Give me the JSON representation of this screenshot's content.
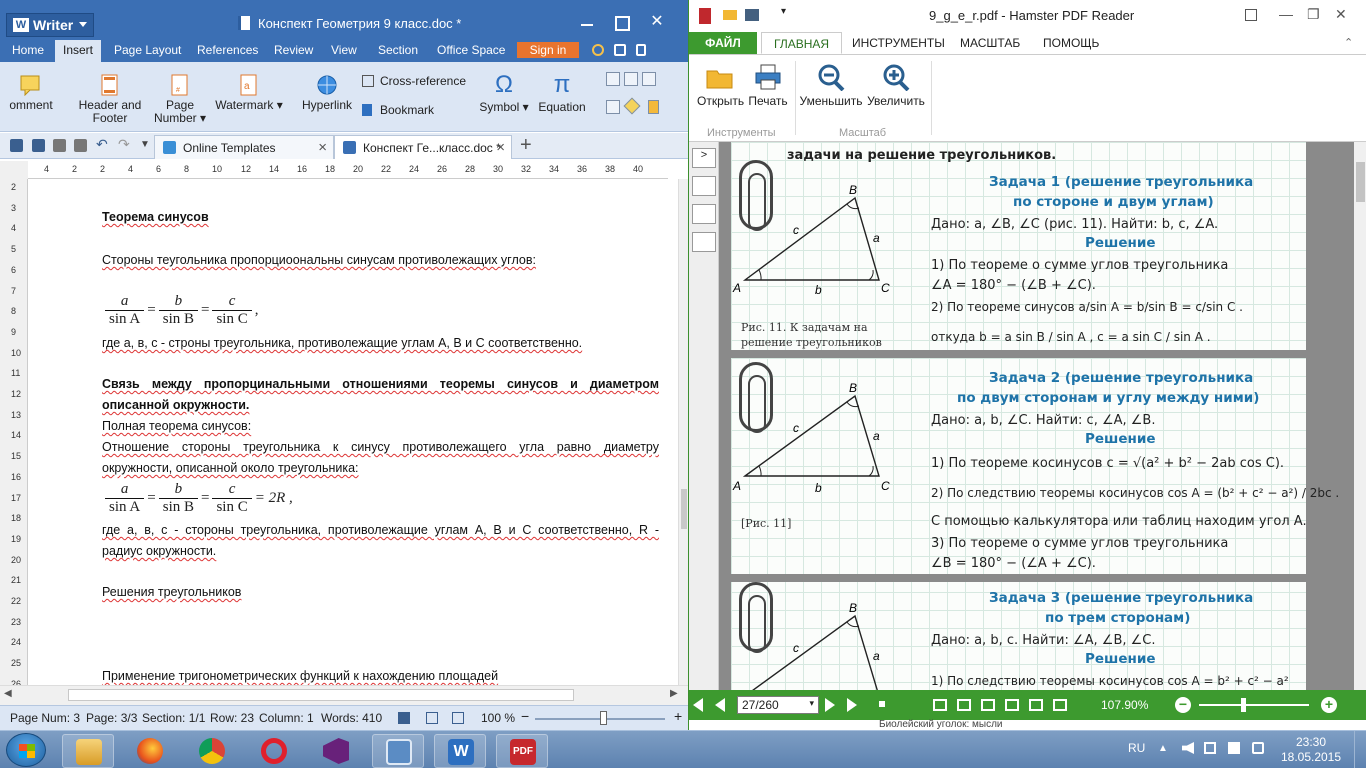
{
  "writer": {
    "app_name": "Writer",
    "doc_title": "Конспект Геометрия 9 класс.doc *",
    "menu_tabs": [
      "Home",
      "Insert",
      "Page Layout",
      "References",
      "Review",
      "View",
      "Section",
      "Office Space"
    ],
    "active_tab": "Insert",
    "signin": "Sign in",
    "ribbon": {
      "comment": "omment",
      "header_footer": [
        "Header and",
        "Footer"
      ],
      "page_number": [
        "Page",
        "Number"
      ],
      "watermark": "Watermark",
      "hyperlink": "Hyperlink",
      "cross_reference": "Cross-reference",
      "bookmark": "Bookmark",
      "symbol": "Symbol",
      "equation": "Equation"
    },
    "tabs": [
      {
        "label": "Online Templates"
      },
      {
        "label": "Конспект Ге...класс.doc *"
      }
    ],
    "ruler_h": [
      "4",
      "2",
      "2",
      "4",
      "6",
      "8",
      "10",
      "12",
      "14",
      "16",
      "18",
      "20",
      "22",
      "24",
      "26",
      "28",
      "30",
      "32",
      "34",
      "36",
      "38",
      "40"
    ],
    "ruler_v": [
      "2",
      "3",
      "4",
      "5",
      "6",
      "7",
      "8",
      "9",
      "10",
      "11",
      "12",
      "13",
      "14",
      "15",
      "16",
      "17",
      "18",
      "19",
      "20",
      "21",
      "22",
      "23",
      "24",
      "25",
      "26"
    ],
    "content": {
      "sine_theorem_title": "Теорема синусов",
      "sides_text": "Стороны теугольника пропорциоональны синусам противолежащих углов:",
      "where1": "где    a, в, с - строны треугольника, противолежащие углам А, В и С соответственно.",
      "relation_title_1": "Связь между пропорцинальными отношениями теоремы синусов и диаметром",
      "relation_title_2": "описанной окружности.",
      "full_theorem": "Полная теорема синусов:",
      "ratio_line1": "Отношение стороны треугольника к синусу противолежащего угла равно диаметру",
      "ratio_line2": "окружности, описанной около треугольника:",
      "where2_line1": "где а, в, с - стороны треугольника, противолежащие углам А, В и С соответственно, R -",
      "where2_line2": "радиус    окружности.",
      "solutions": "Решения треугольников",
      "application": "Применение тригонометрических функций к нахождению площадей",
      "formula1": {
        "nums": [
          "a",
          "b",
          "c"
        ],
        "dens": [
          "sin A",
          "sin B",
          "sin C"
        ],
        "tail": ","
      },
      "formula2": {
        "nums": [
          "a",
          "b",
          "c"
        ],
        "dens": [
          "sin A",
          "sin B",
          "sin C"
        ],
        "tail": "= 2R ,"
      }
    },
    "status": {
      "page_num": "Page Num: 3",
      "page": "Page: 3/3",
      "section": "Section: 1/1",
      "row": "Row: 23",
      "column": "Column: 1",
      "words": "Words: 410",
      "zoom": "100 %"
    }
  },
  "pdf": {
    "title": "9_g_e_r.pdf - Hamster PDF Reader",
    "menus": [
      "ФАЙЛ",
      "ГЛАВНАЯ",
      "ИНСТРУМЕНТЫ",
      "МАСШТАБ",
      "ПОМОЩЬ"
    ],
    "ribbon": {
      "open": "Открыть",
      "print": "Печать",
      "zoom_out": "Уменьшить",
      "zoom_in": "Увеличить",
      "group_tools": "Инструменты",
      "group_zoom": "Масштаб"
    },
    "page_content": {
      "top_line": "задачи на решение треугольников.",
      "task1_title_1": "Задача 1 (решение треугольника",
      "task1_title_2": "по стороне и двум углам)",
      "task1_given": "Дано: a, ∠B, ∠C (рис. 11). Найти: b, c, ∠A.",
      "solution": "Решение",
      "task1_s1a": "1) По теореме о сумме углов треугольника",
      "task1_s1b": "∠A = 180° − (∠B + ∠C).",
      "task1_s2": "2) По теореме синусов  a/sin A = b/sin B = c/sin C .",
      "task1_s3": "откуда  b = a sin B / sin A ,   c = a sin C / sin A .",
      "fig_caption": "Рис. 11. К задачам на решение треугольников",
      "task2_title_1": "Задача 2 (решение треугольника",
      "task2_title_2": "по двум сторонам и углу между ними)",
      "task2_given": "Дано: a, b, ∠C. Найти: c, ∠A, ∠B.",
      "task2_s1": "1) По теореме косинусов  c = √(a² + b² − 2ab cos C).",
      "task2_s2": "2) По следствию теоремы косинусов  cos A = (b² + c² − a²) / 2bc .",
      "task2_fig": "[Рис. 11]",
      "task2_calc": "С помощью калькулятора или таблиц находим угол A.",
      "task2_s3a": "3) По теореме о сумме углов треугольника",
      "task2_s3b": "∠B = 180° − (∠A + ∠C).",
      "task3_title_1": "Задача 3 (решение треугольника",
      "task3_title_2": "по трем сторонам)",
      "task3_given": "Дано: a, b, c. Найти: ∠A, ∠B, ∠C.",
      "task3_s1": "1) По следствию теоремы косинусов  cos A = b² + c² − a²",
      "labels": {
        "A": "A",
        "B": "B",
        "C": "C",
        "a": "a",
        "b": "b",
        "c": "c"
      }
    },
    "status": {
      "page_box": "27/260",
      "zoom": "107.90%"
    },
    "notification": "Биолейский уголок: мысли"
  },
  "taskbar": {
    "lang": "RU",
    "time": "23:30",
    "date": "18.05.2015"
  }
}
